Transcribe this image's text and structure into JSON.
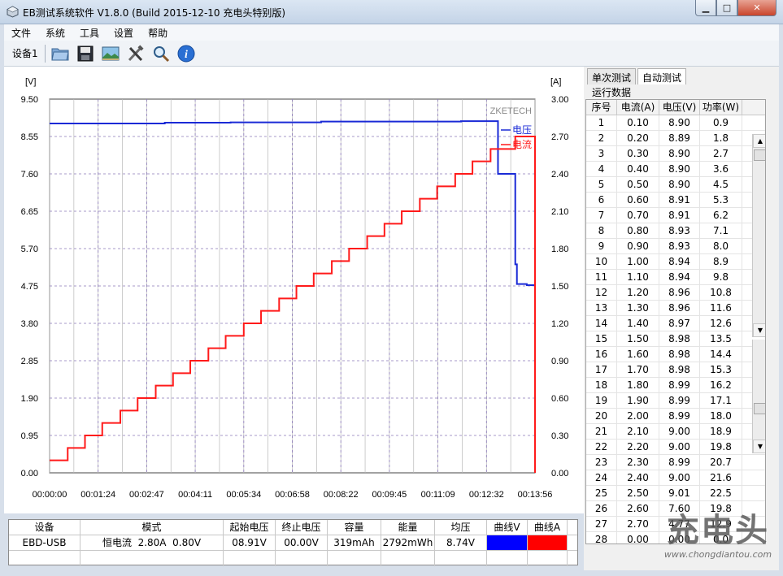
{
  "window": {
    "title": "EB测试系统软件 V1.8.0 (Build 2015-12-10 充电头特别版)",
    "min_symbol": "▁",
    "max_symbol": "□",
    "close_symbol": "✕"
  },
  "menu": [
    "文件",
    "系统",
    "工具",
    "设置",
    "帮助"
  ],
  "toolbar": {
    "device_label": "设备1",
    "buttons": [
      "folder-icon",
      "save-icon",
      "picture-icon",
      "tools-icon",
      "search-icon",
      "info-icon"
    ]
  },
  "chart_data": {
    "type": "line",
    "yleft_unit": "[V]",
    "yright_unit": "[A]",
    "yleft_ticks": [
      "9.50",
      "8.55",
      "7.60",
      "6.65",
      "5.70",
      "4.75",
      "3.80",
      "2.85",
      "1.90",
      "0.95",
      "0.00"
    ],
    "yright_ticks": [
      "3.00",
      "2.70",
      "2.40",
      "2.10",
      "1.80",
      "1.50",
      "1.20",
      "0.90",
      "0.60",
      "0.30",
      "0.00"
    ],
    "x_ticks": [
      "00:00:00",
      "00:01:24",
      "00:02:47",
      "00:04:11",
      "00:05:34",
      "00:06:58",
      "00:08:22",
      "00:09:45",
      "00:11:09",
      "00:12:32",
      "00:13:56"
    ],
    "yleft_range": [
      0,
      9.5
    ],
    "yright_range": [
      0,
      3.0
    ],
    "brand_label": "ZKETECH",
    "legend": [
      {
        "name": "电压",
        "color": "#1a2ad6"
      },
      {
        "name": "电流",
        "color": "#ff1a1a"
      }
    ],
    "series": [
      {
        "name": "电压",
        "axis": "left",
        "color": "#1a2ad6",
        "points": [
          [
            0,
            8.88
          ],
          [
            130,
            8.88
          ],
          [
            140,
            8.9
          ],
          [
            200,
            8.9
          ],
          [
            220,
            8.91
          ],
          [
            320,
            8.91
          ],
          [
            330,
            8.93
          ],
          [
            480,
            8.93
          ],
          [
            500,
            8.94
          ],
          [
            545,
            8.94
          ],
          [
            545,
            7.6
          ],
          [
            565,
            7.6
          ],
          [
            566,
            5.3
          ],
          [
            568,
            4.8
          ],
          [
            580,
            4.77
          ],
          [
            588,
            4.75
          ]
        ]
      },
      {
        "name": "电流",
        "axis": "right",
        "color": "#ff1a1a",
        "points": [
          [
            0,
            0.1
          ],
          [
            22,
            0.2
          ],
          [
            43,
            0.3
          ],
          [
            64,
            0.4
          ],
          [
            86,
            0.5
          ],
          [
            107,
            0.6
          ],
          [
            129,
            0.7
          ],
          [
            150,
            0.8
          ],
          [
            171,
            0.9
          ],
          [
            193,
            1.0
          ],
          [
            214,
            1.1
          ],
          [
            236,
            1.2
          ],
          [
            257,
            1.3
          ],
          [
            279,
            1.4
          ],
          [
            300,
            1.5
          ],
          [
            321,
            1.6
          ],
          [
            343,
            1.7
          ],
          [
            364,
            1.8
          ],
          [
            386,
            1.9
          ],
          [
            407,
            2.0
          ],
          [
            428,
            2.1
          ],
          [
            450,
            2.2
          ],
          [
            471,
            2.3
          ],
          [
            493,
            2.4
          ],
          [
            514,
            2.5
          ],
          [
            536,
            2.6
          ],
          [
            545,
            2.6
          ],
          [
            545,
            2.6
          ],
          [
            566,
            2.7
          ],
          [
            587,
            2.7
          ],
          [
            590,
            2.7
          ],
          [
            590,
            0.0
          ]
        ]
      }
    ]
  },
  "right_panel": {
    "tabs": [
      "单次测试",
      "自动测试"
    ],
    "active_tab": 1,
    "group_label": "运行数据",
    "columns": [
      "序号",
      "电流(A)",
      "电压(V)",
      "功率(W)"
    ],
    "rows": [
      [
        "1",
        "0.10",
        "8.90",
        "0.9"
      ],
      [
        "2",
        "0.20",
        "8.89",
        "1.8"
      ],
      [
        "3",
        "0.30",
        "8.90",
        "2.7"
      ],
      [
        "4",
        "0.40",
        "8.90",
        "3.6"
      ],
      [
        "5",
        "0.50",
        "8.90",
        "4.5"
      ],
      [
        "6",
        "0.60",
        "8.91",
        "5.3"
      ],
      [
        "7",
        "0.70",
        "8.91",
        "6.2"
      ],
      [
        "8",
        "0.80",
        "8.93",
        "7.1"
      ],
      [
        "9",
        "0.90",
        "8.93",
        "8.0"
      ],
      [
        "10",
        "1.00",
        "8.94",
        "8.9"
      ],
      [
        "11",
        "1.10",
        "8.94",
        "9.8"
      ],
      [
        "12",
        "1.20",
        "8.96",
        "10.8"
      ],
      [
        "13",
        "1.30",
        "8.96",
        "11.6"
      ],
      [
        "14",
        "1.40",
        "8.97",
        "12.6"
      ],
      [
        "15",
        "1.50",
        "8.98",
        "13.5"
      ],
      [
        "16",
        "1.60",
        "8.98",
        "14.4"
      ],
      [
        "17",
        "1.70",
        "8.98",
        "15.3"
      ],
      [
        "18",
        "1.80",
        "8.99",
        "16.2"
      ],
      [
        "19",
        "1.90",
        "8.99",
        "17.1"
      ],
      [
        "20",
        "2.00",
        "8.99",
        "18.0"
      ],
      [
        "21",
        "2.10",
        "9.00",
        "18.9"
      ],
      [
        "22",
        "2.20",
        "9.00",
        "19.8"
      ],
      [
        "23",
        "2.30",
        "8.99",
        "20.7"
      ],
      [
        "24",
        "2.40",
        "9.00",
        "21.6"
      ],
      [
        "25",
        "2.50",
        "9.01",
        "22.5"
      ],
      [
        "26",
        "2.60",
        "7.60",
        "19.8"
      ],
      [
        "27",
        "2.70",
        "4.77",
        "12.9"
      ],
      [
        "28",
        "0.00",
        "0.00",
        "0.0"
      ]
    ]
  },
  "summary_table": {
    "headers": [
      "设备",
      "模式",
      "起始电压",
      "终止电压",
      "容量",
      "能量",
      "均压",
      "曲线V",
      "曲线A"
    ],
    "values": [
      "EBD-USB",
      "恒电流  2.80A  0.80V",
      "08.91V",
      "00.00V",
      "319mAh",
      "2792mWh",
      "8.74V",
      "",
      ""
    ],
    "curve_colors": [
      "#0000ff",
      "#ff0000"
    ]
  },
  "watermark": {
    "brand": "充电头",
    "url": "www.chongdiantou.com"
  }
}
